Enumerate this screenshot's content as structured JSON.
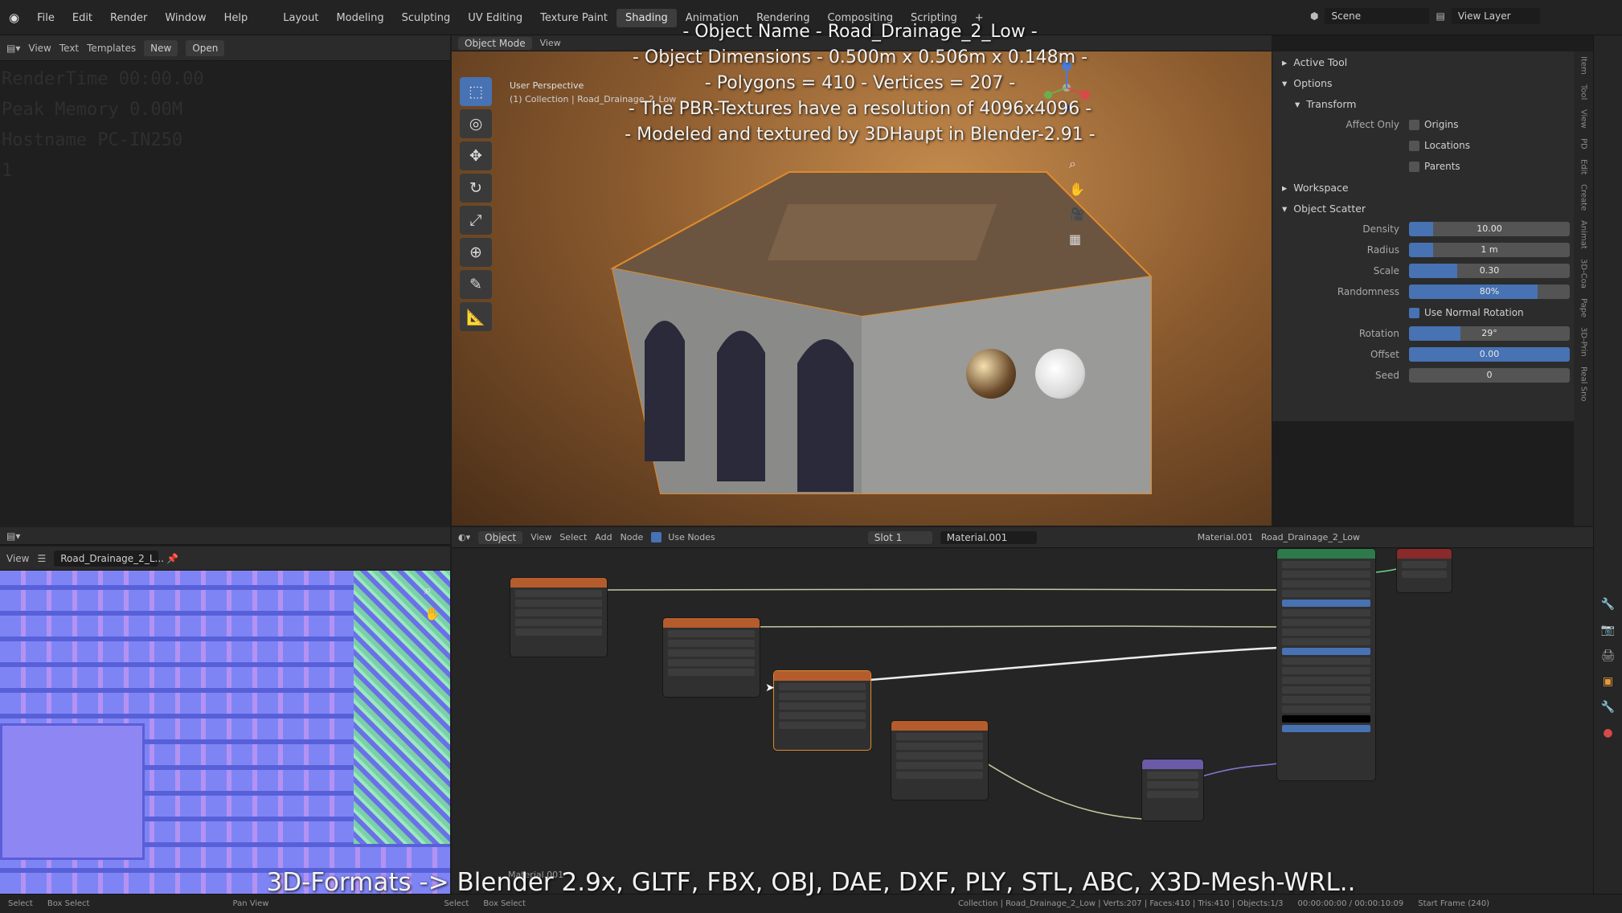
{
  "topbar": {
    "menus": [
      "File",
      "Edit",
      "Render",
      "Window",
      "Help"
    ],
    "workspaces": [
      "Layout",
      "Modeling",
      "Sculpting",
      "UV Editing",
      "Texture Paint",
      "Shading",
      "Animation",
      "Rendering",
      "Compositing",
      "Scripting"
    ],
    "active_workspace": "Shading",
    "scene": "Scene",
    "view_layer": "View Layer",
    "add_tab": "+"
  },
  "text_editor": {
    "header": {
      "view": "View",
      "text": "Text",
      "templates": "Templates",
      "new": "New",
      "open": "Open"
    },
    "lines": [
      "RenderTime 00:00.00",
      "Peak Memory 0.00M",
      "Hostname PC-IN250",
      "1"
    ]
  },
  "viewport": {
    "mode": "Object Mode",
    "view_menu": "View",
    "perspective": "User Perspective",
    "collection": "(1) Collection | Road_Drainage_2_Low",
    "options": "Options"
  },
  "overlay_text": {
    "line1": "- Object Name - Road_Drainage_2_Low -",
    "line2": "- Object Dimensions -  0.500m x 0.506m x 0.148m -",
    "line3": "- Polygons = 410  -  Vertices = 207 -",
    "line4": "- The PBR-Textures have a resolution of 4096x4096 -",
    "line5": "- Modeled and textured by 3DHaupt in Blender-2.91 -",
    "footer": "3D-Formats -> Blender 2.9x, GLTF, FBX, OBJ, DAE, DXF, PLY, STL, ABC, X3D-Mesh-WRL.."
  },
  "n_panel": {
    "active_tool": "Active Tool",
    "options": "Options",
    "transform": "Transform",
    "affect_only": "Affect Only",
    "origins": "Origins",
    "locations": "Locations",
    "parents": "Parents",
    "workspace": "Workspace",
    "object_scatter": "Object Scatter",
    "fields": [
      {
        "label": "Density",
        "value": "10.00",
        "fill": 0.15
      },
      {
        "label": "Radius",
        "value": "1 m",
        "fill": 0.15
      },
      {
        "label": "Scale",
        "value": "0.30",
        "fill": 0.3
      },
      {
        "label": "Randomness",
        "value": "80%",
        "fill": 0.8
      }
    ],
    "use_normal_rotation": "Use Normal Rotation",
    "fields2": [
      {
        "label": "Rotation",
        "value": "29°",
        "fill": 0.32
      },
      {
        "label": "Offset",
        "value": "0.00",
        "fill": 1.0
      },
      {
        "label": "Seed",
        "value": "0",
        "fill": 0.0
      }
    ],
    "side_tabs": [
      "Item",
      "Tool",
      "View",
      "PD",
      "Edit",
      "Create",
      "Animat",
      "3D-Coa",
      "Pape",
      "3D-Prin",
      "Real Sno"
    ]
  },
  "image_editor": {
    "view": "View",
    "image_name": "Road_Drainage_2_L..."
  },
  "node_editor": {
    "object": "Object",
    "view": "View",
    "select": "Select",
    "add": "Add",
    "node": "Node",
    "use_nodes": "Use Nodes",
    "slot": "Slot 1",
    "material": "Material.001",
    "material_right": "Material.001",
    "object_name": "Road_Drainage_2_Low",
    "label_bottom": "Material.001"
  },
  "statusbar": {
    "select": "Select",
    "box_select": "Box Select",
    "pan_view": "Pan View",
    "select2": "Select",
    "box_select2": "Box Select",
    "stats": "Collection | Road_Drainage_2_Low | Verts:207 | Faces:410 | Tris:410 | Objects:1/3",
    "time": "00:00:00:00 / 00:00:10:09",
    "frame": "Start Frame (240)"
  },
  "colors": {
    "accent": "#4772b3",
    "node_header_texture": "#b55c2d",
    "node_header_normal": "#6a5aa8",
    "node_header_output": "#8a2a2a",
    "node_header_bsdf": "#2d7a4a"
  }
}
